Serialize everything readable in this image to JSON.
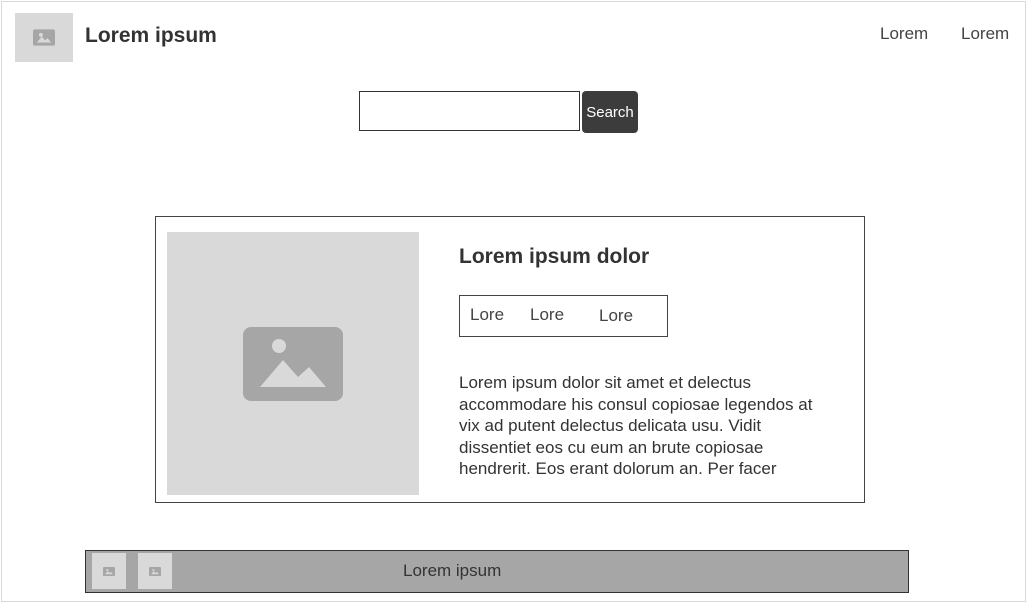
{
  "header": {
    "logo_icon": "image-placeholder-icon",
    "title": "Lorem ipsum",
    "nav_links": [
      "Lorem",
      "Lorem"
    ]
  },
  "search": {
    "value": "",
    "placeholder": "",
    "button_label": "Search"
  },
  "card": {
    "image_icon": "image-placeholder-icon",
    "title": "Lorem ipsum dolor",
    "tags": [
      "Lore",
      "Lore",
      "Lore"
    ],
    "description": "Lorem ipsum dolor sit amet et delectus accommodare his consul copiosae legendos at vix ad putent delectus delicata usu. Vidit dissentiet eos cu eum an brute copiosae hendrerit. Eos erant dolorum an. Per facer"
  },
  "footer": {
    "icons": [
      "image-placeholder-icon",
      "image-placeholder-icon"
    ],
    "text": "Lorem ipsum"
  },
  "colors": {
    "placeholder_bg": "#d9d9d9",
    "placeholder_icon": "#a6a6a6",
    "text": "#333333",
    "button_bg": "#3c3c3c",
    "footer_bg": "#a6a6a6"
  }
}
